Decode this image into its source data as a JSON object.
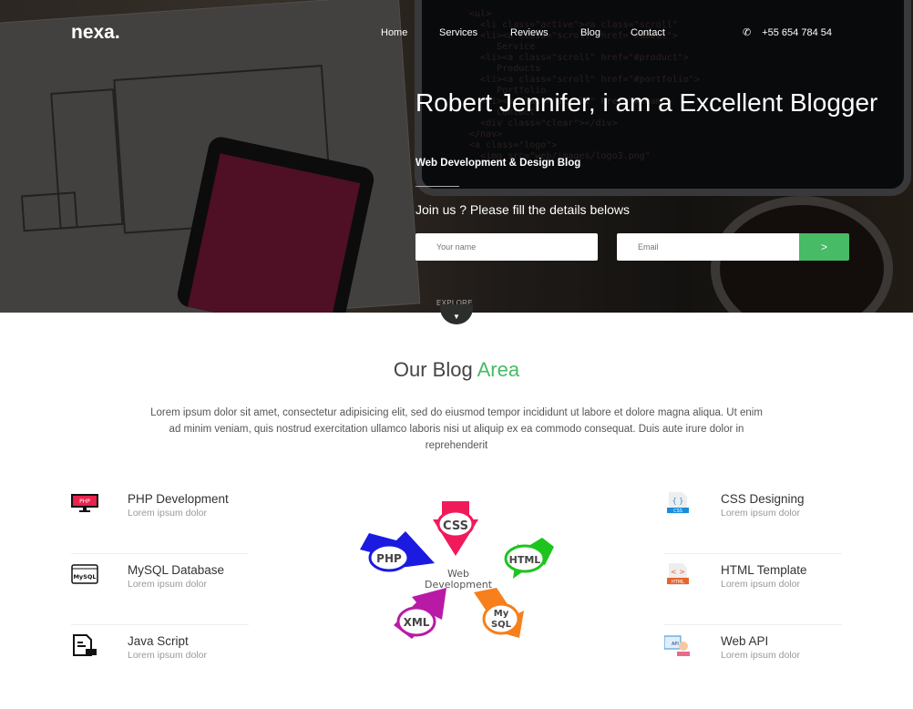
{
  "header": {
    "logo": "nexa.",
    "nav": [
      "Home",
      "Services",
      "Reviews",
      "Blog",
      "Contact"
    ],
    "phone": "+55 654 784 54"
  },
  "hero": {
    "title": "Robert Jennifer, i am a Excellent Blogger",
    "subtitle": "Web Development & Design Blog",
    "join_text": "Join us ? Please fill the details belows",
    "name_placeholder": "Your name",
    "email_placeholder": "Email",
    "submit_label": ">",
    "explore_label": "EXPLORE"
  },
  "blog": {
    "title_main": "Our Blog",
    "title_accent": "Area",
    "accent_color": "#47bb66",
    "description": "Lorem ipsum dolor sit amet, consectetur adipisicing elit, sed do eiusmod tempor incididunt ut labore et dolore magna aliqua. Ut enim ad minim veniam, quis nostrud exercitation ullamco laboris nisi ut aliquip ex ea commodo consequat. Duis aute irure dolor in reprehenderit",
    "diagram": {
      "center": "Web Development",
      "items": [
        "CSS",
        "HTML",
        "My SQL",
        "XML",
        "PHP"
      ]
    },
    "left": [
      {
        "title": "PHP Development",
        "sub": "Lorem ipsum dolor",
        "icon": "php-monitor-icon"
      },
      {
        "title": "MySQL Database",
        "sub": "Lorem ipsum dolor",
        "icon": "mysql-window-icon"
      },
      {
        "title": "Java Script",
        "sub": "Lorem ipsum dolor",
        "icon": "js-file-icon"
      }
    ],
    "right": [
      {
        "title": "CSS Designing",
        "sub": "Lorem ipsum dolor",
        "icon": "css-file-icon"
      },
      {
        "title": "HTML Template",
        "sub": "Lorem ipsum dolor",
        "icon": "html-file-icon"
      },
      {
        "title": "Web API",
        "sub": "Lorem ipsum dolor",
        "icon": "web-api-icon"
      }
    ]
  }
}
